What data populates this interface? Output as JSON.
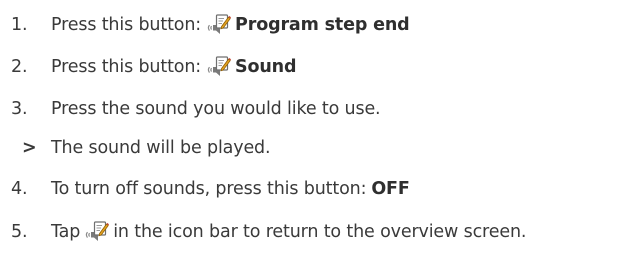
{
  "steps": [
    {
      "number": "1.",
      "text": "Press this button:",
      "icon": "program-settings-icon",
      "emphasis": "Program step end"
    },
    {
      "number": "2.",
      "text": "Press this button:",
      "icon": "program-settings-icon",
      "emphasis": "Sound"
    },
    {
      "number": "3.",
      "text": "Press the sound you would like to use."
    },
    {
      "marker": ">",
      "text": "The sound will be played."
    },
    {
      "number": "4.",
      "text": "To turn off sounds, press this button:",
      "emphasis": "OFF"
    },
    {
      "number": "5.",
      "text_before": "Tap",
      "icon": "program-settings-icon",
      "text_after": "in the icon bar to return to the overview screen."
    }
  ]
}
